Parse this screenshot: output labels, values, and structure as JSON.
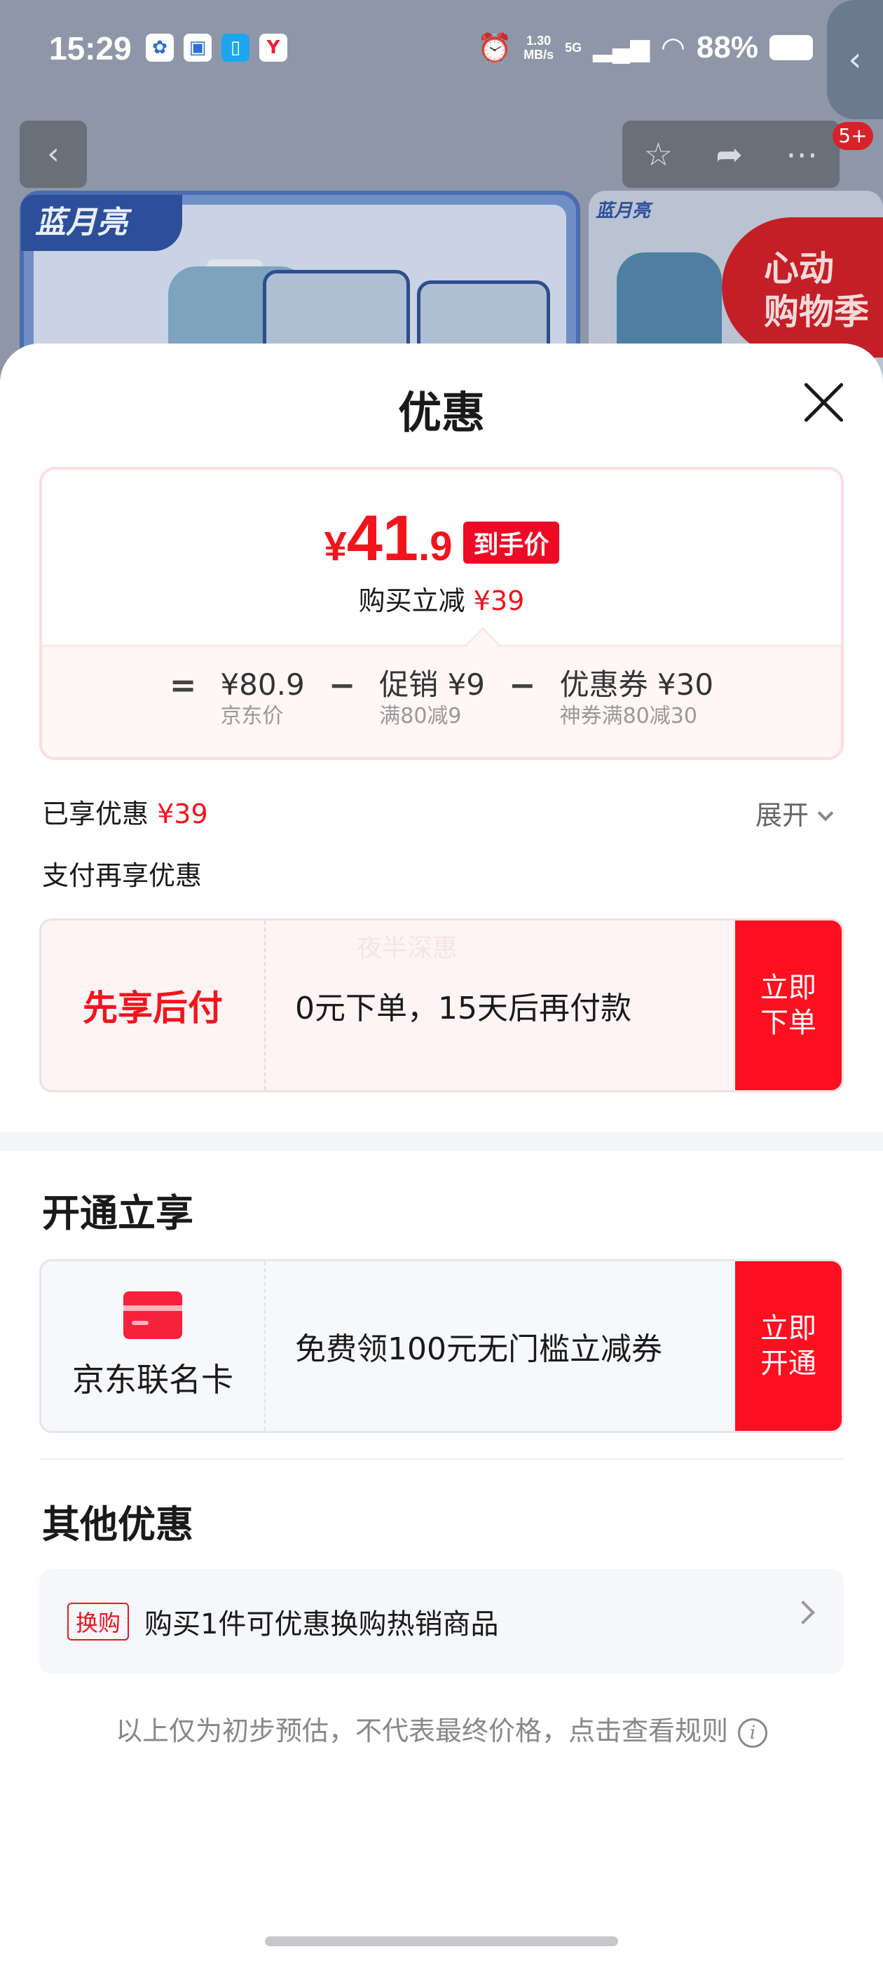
{
  "status_bar": {
    "time": "15:29",
    "speed_value": "1.30",
    "speed_unit": "MB/s",
    "network": "5G",
    "battery": "88%"
  },
  "background": {
    "brand_logo": "蓝月亮",
    "promo_badge_line1": "心动",
    "promo_badge_line2": "购物季",
    "message_count": "5+"
  },
  "sheet": {
    "title": "优惠",
    "price_card": {
      "currency": "¥",
      "price_int": "41",
      "price_dec": ".9",
      "final_tag": "到手价",
      "saving_label": "购买立减",
      "saving_value": "¥39",
      "eq": "=",
      "minus": "−",
      "terms": [
        {
          "value": "¥80.9",
          "sub": "京东价"
        },
        {
          "value": "促销 ¥9",
          "sub": "满80减9"
        },
        {
          "value": "优惠券 ¥30",
          "sub": "神券满80减30"
        }
      ]
    },
    "enjoyed_label": "已享优惠",
    "enjoyed_value": "¥39",
    "expand_label": "展开",
    "pay_more_label": "支付再享优惠",
    "pay_later": {
      "label": "先享后付",
      "watermark": "夜半深惠",
      "desc": "0元下单，15天后再付款",
      "button": "立即下单"
    },
    "open_section_title": "开通立享",
    "card_offer": {
      "label": "京东联名卡",
      "desc": "免费领100元无门槛立减券",
      "button": "立即开通"
    },
    "other_section_title": "其他优惠",
    "other_offer": {
      "tag": "换购",
      "text": "购买1件可优惠换购热销商品"
    },
    "disclaimer": "以上仅为初步预估，不代表最终价格，点击查看规则"
  },
  "colors": {
    "accent_red": "#f2141c",
    "button_red": "#ff0f1f"
  },
  "icons": [
    "back-icon",
    "star-icon",
    "share-icon",
    "more-icon",
    "close-icon",
    "chevron-down-icon",
    "credit-card-icon",
    "chevron-right-icon",
    "info-icon"
  ]
}
